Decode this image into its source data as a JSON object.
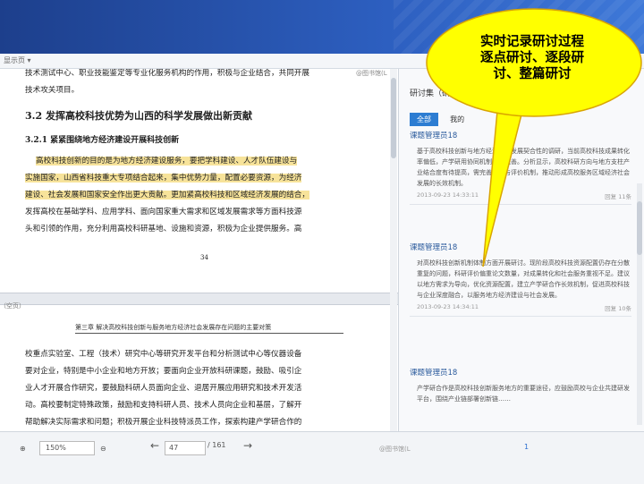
{
  "app": {
    "topbar_dropdown": "显示页 ▾",
    "brand": "@图书馆(L",
    "brand_side": "@图书馆(L",
    "brand_bottom": "@图书馆(L"
  },
  "document": {
    "para1": "技术测试中心、职业技能鉴定等专业化服务机构的作用，积极与企业结合，共同开展",
    "para2": "技术攻关项目。",
    "heading1": "3.2 发挥高校科技优势为山西的科学发展做出新贡献",
    "heading2": "3.2.1 紧紧围绕地方经济建设开展科技创新",
    "hl_line1": "高校科技创新的目的是为地方经济建设服务，要把学科建设、人才队伍建设与",
    "hl_line2": "实施国家，山西省科技重大专项结合起来，集中优势力量，配置必要资源，为经济",
    "hl_line3": "建设、社会发展和国家安全作出更大贡献。更加紧高校科技和区域经济发展的结合，",
    "para3": "发挥高校在基础学科、应用学科、面向国家重大需求和区域发展需求等方面科技源",
    "para4": "头和引领的作用，充分利用高校科研基地、设施和资源，积极为企业提供服务。高",
    "page_number": "34",
    "side_label": "（空页）",
    "chapter_header": "第三章  解决高校科技创新与服务地方经济社会发展存在问题的主要对策",
    "p2_line1": "校重点实验室、工程（技术）研究中心等研究开发平台和分析测试中心等仪器设备",
    "p2_line2": "要对企业，特别是中小企业和地方开放；要面向企业开放科研课题，鼓励、吸引企",
    "p2_line3": "业人才开展合作研究，要鼓励科研人员面向企业、退居开展应用研究和技术开发活",
    "p2_line4": "动。高校要制定特殊政策，鼓励和支持科研人员、技术人员向企业和基层，了解开",
    "p2_line5": "帮助解决实际需求和问题；积极开展企业科技特派员工作，探索构建产学研合作的"
  },
  "sidebar": {
    "header": "研讨集（研讨群组）",
    "tabs": [
      "全部",
      "我的"
    ],
    "cards": [
      {
        "title": "课题管理员18",
        "body": "基于高校科技创新与地方经济社会发展契合性的调研，当前高校科技成果转化率偏低，产学研用协同机制尚待完善。分析显示，高校科研方向与地方支柱产业结合度有待提高，需完善激励与评价机制，推动形成高校服务区域经济社会发展的长效机制。",
        "time": "2013-09-23 14:33:11",
        "reply": "回复 11条"
      },
      {
        "title": "课题管理员18",
        "body": "对高校科技创新机制体制方面开展研讨。现阶段高校科技资源配置仍存在分散重复的问题，科研评价偏重论文数量，对成果转化和社会服务重视不足。建议以地方需求为导向，优化资源配置，建立产学研合作长效机制，促进高校科技与企业深度融合，以服务地方经济建设与社会发展。",
        "time": "2013-09-23 14:34:11",
        "reply": "回复 10条"
      },
      {
        "title": "课题管理员18",
        "body": "产学研合作是高校科技创新服务地方的重要途径，应鼓励高校与企业共建研发平台，围绕产业链部署创新链……",
        "time": "",
        "reply": ""
      }
    ]
  },
  "bottombar": {
    "zoom_in_icon": "⊕",
    "zoom_value": "150%",
    "zoom_out_icon": "⊖",
    "prev_icon": "←",
    "page_input": "47",
    "page_total": "/ 161",
    "next_icon": "→",
    "page_link": "1"
  },
  "callout": {
    "line1": "实时记录研讨过程",
    "line2": "逐点研讨、逐段研",
    "line3": "讨、整篇研讨",
    "fill": "#ffff00",
    "stroke": "#d9a400"
  },
  "colors": {
    "highlight": "#f7e39a",
    "accent": "#2d7dd2",
    "banner": "#2d5fc0"
  }
}
